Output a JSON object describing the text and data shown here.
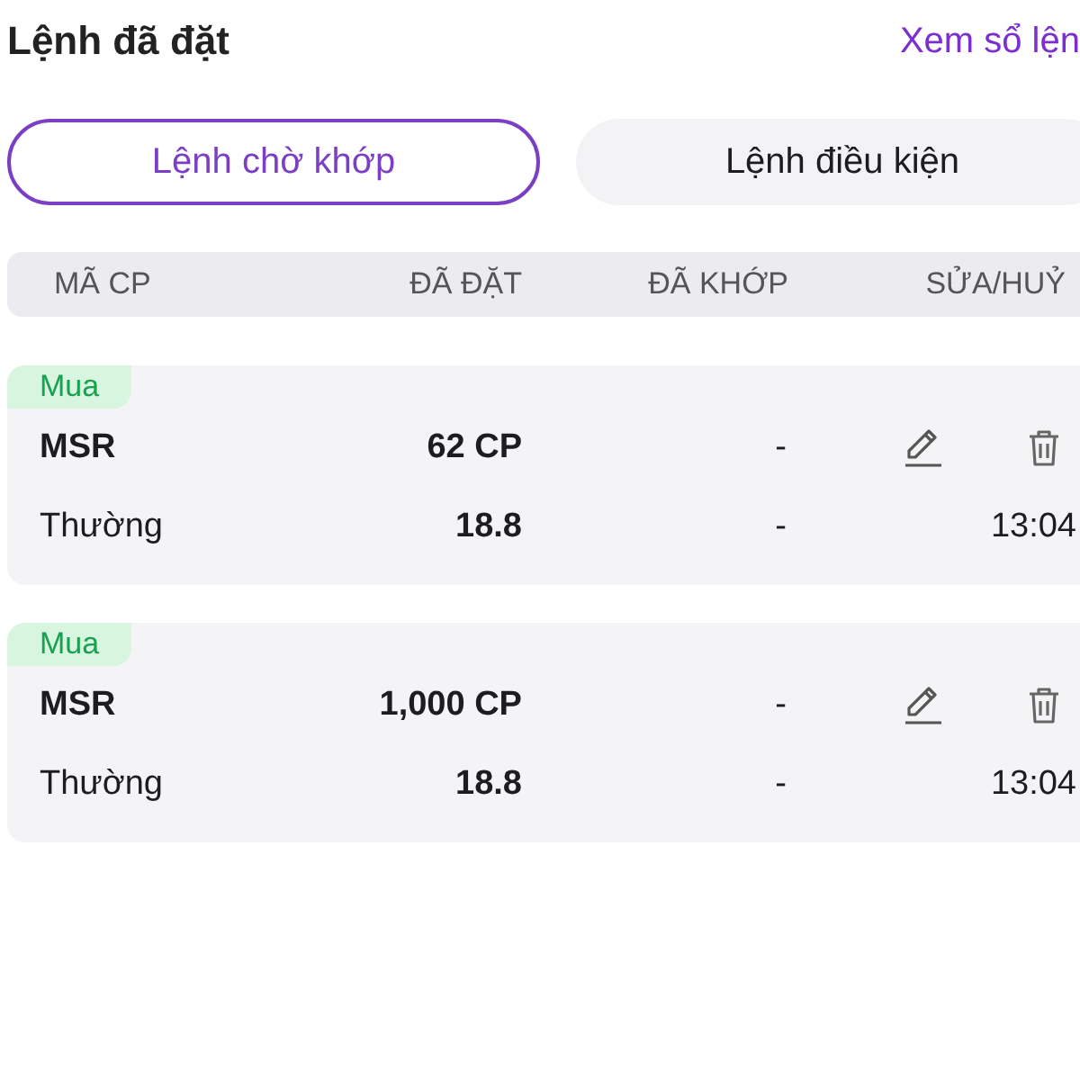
{
  "header": {
    "title": "Lệnh đã đặt",
    "link": "Xem sổ lện"
  },
  "tabs": [
    {
      "label": "Lệnh chờ khớp",
      "selected": true
    },
    {
      "label": "Lệnh điều kiện",
      "selected": false
    }
  ],
  "table": {
    "columns": [
      "MÃ CP",
      "ĐÃ ĐẶT",
      "ĐÃ KHỚP",
      "SỬA/HUỶ"
    ],
    "orders": [
      {
        "kind": "buy",
        "side_label": "Mua",
        "symbol": "MSR",
        "quantity": "62 CP",
        "matched_quantity": "-",
        "order_type": "Thường",
        "price": "18.8",
        "matched_price": "-",
        "time": "13:04"
      },
      {
        "kind": "buy",
        "side_label": "Mua",
        "symbol": "MSR",
        "quantity": "1,000 CP",
        "matched_quantity": "-",
        "order_type": "Thường",
        "price": "18.8",
        "matched_price": "-",
        "time": "13:04"
      }
    ]
  }
}
